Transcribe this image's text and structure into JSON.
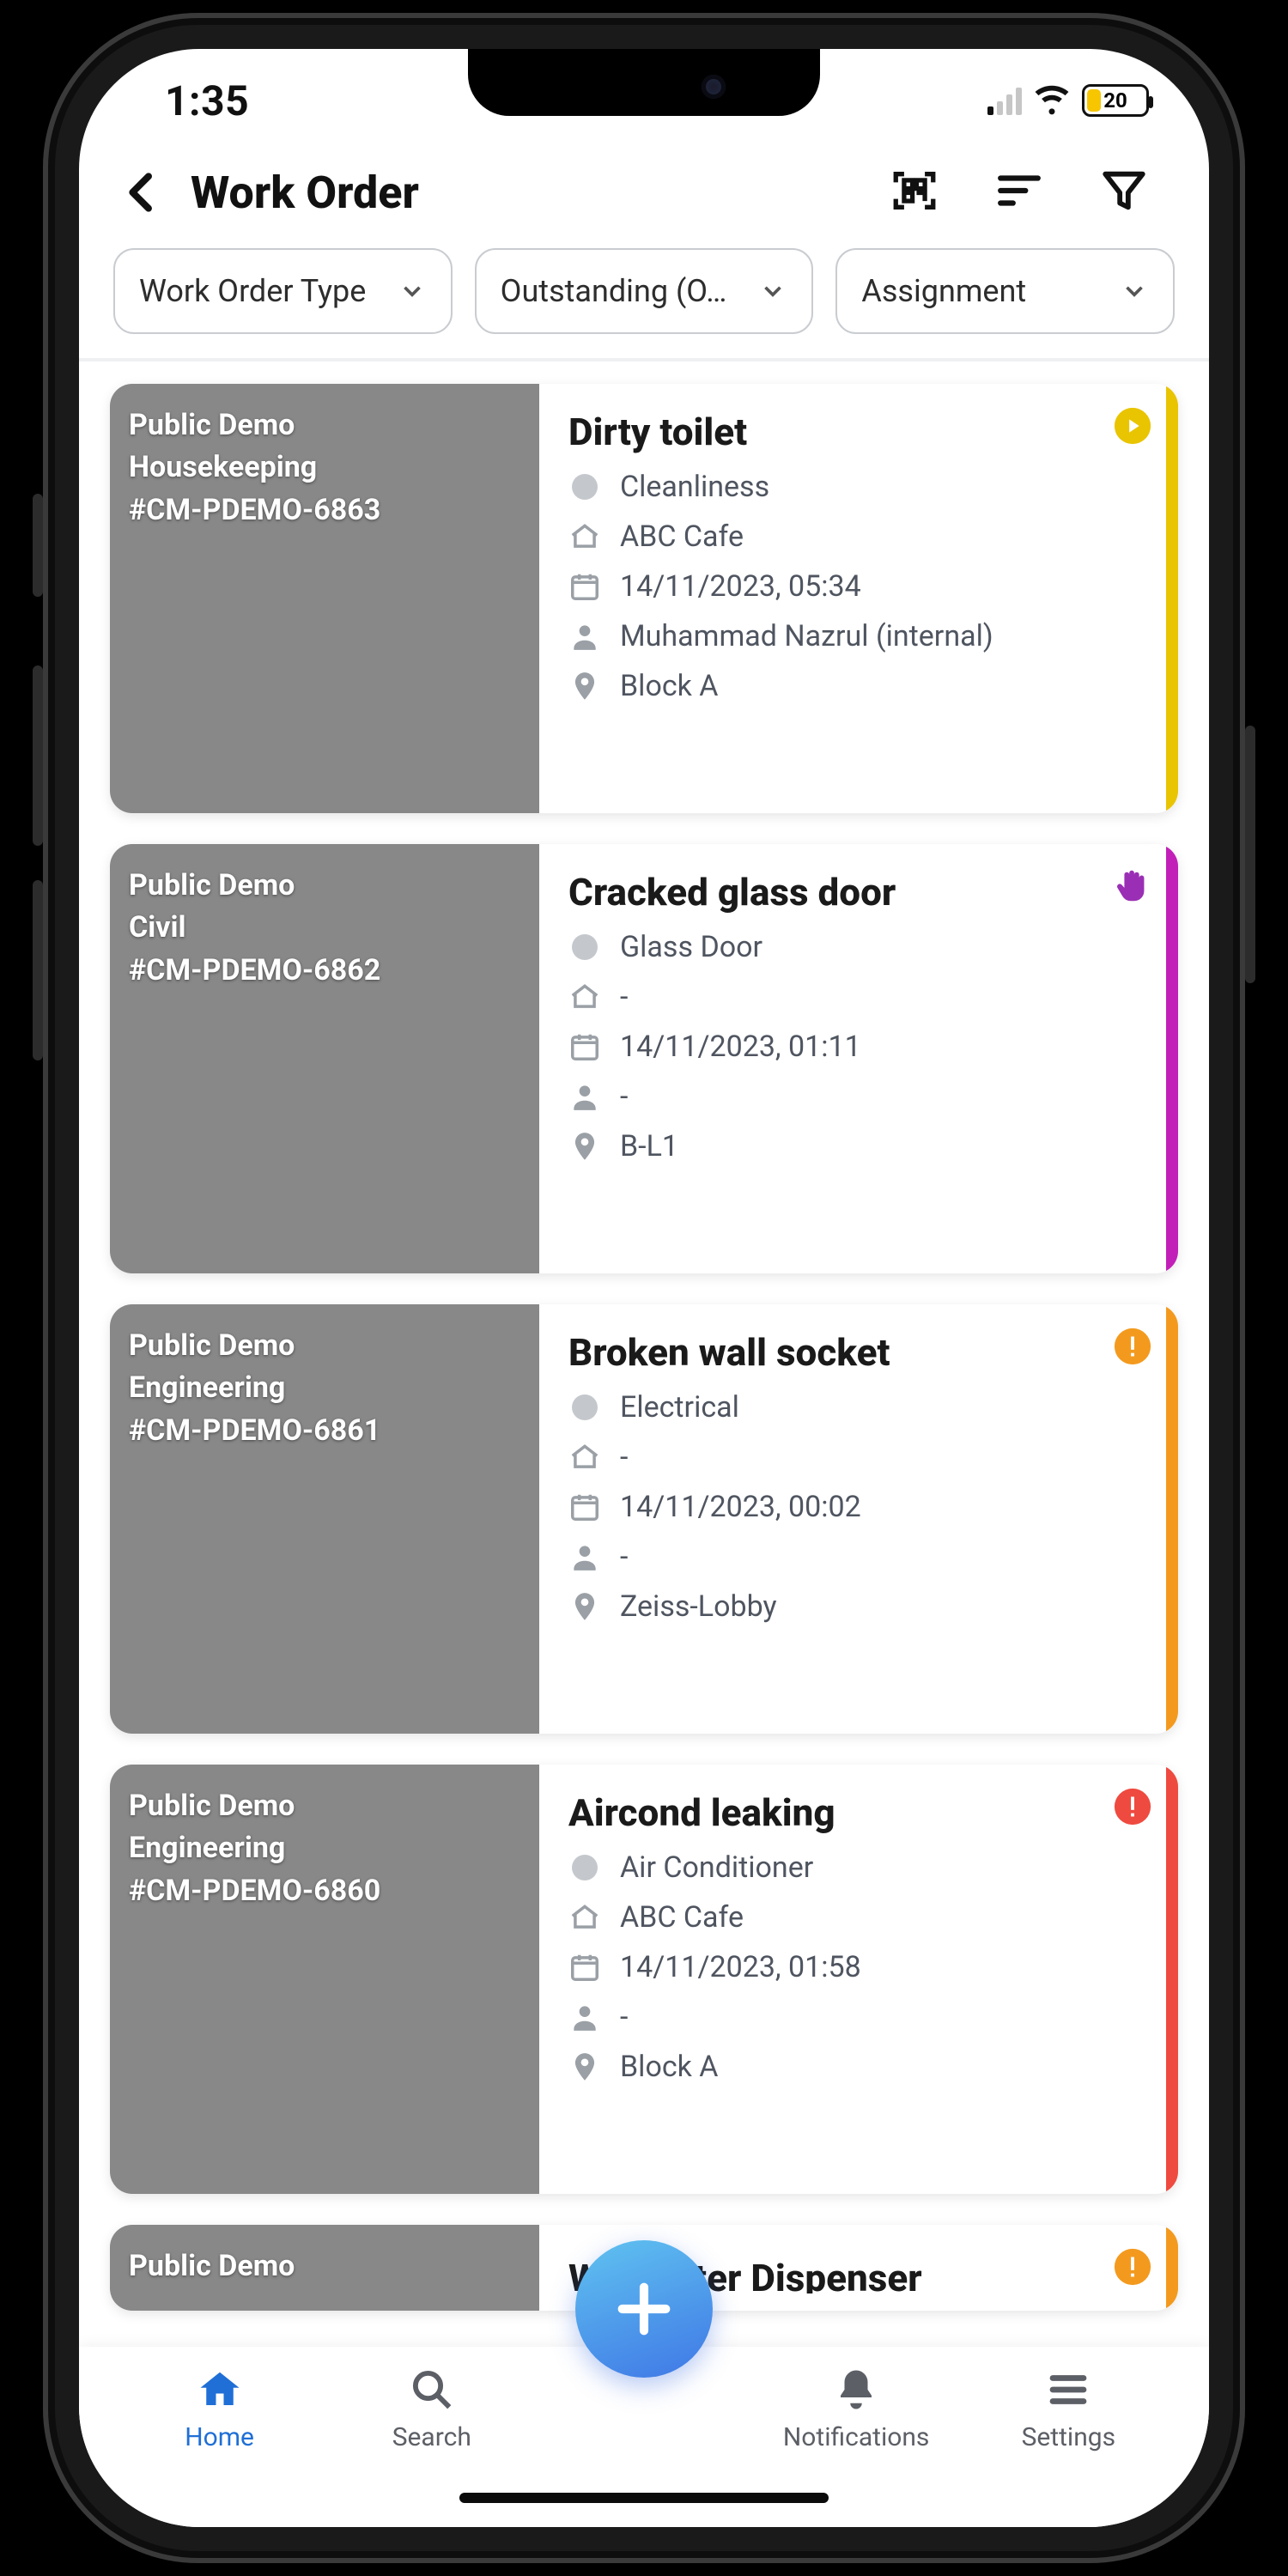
{
  "device": {
    "time": "1:35",
    "battery_pct": "20"
  },
  "header": {
    "title": "Work Order"
  },
  "filters": {
    "type": {
      "label": "Work Order Type"
    },
    "status": {
      "label": "Outstanding (O…"
    },
    "assign": {
      "label": "Assignment"
    }
  },
  "stripe_colors": {
    "yellow": "#e9c400",
    "magenta": "#c21fb9",
    "orange": "#f39a1e",
    "red": "#ef4a3f"
  },
  "badge_colors": {
    "play": "#e9c400",
    "hand": "#9a2fb5",
    "warn_o": "#f39a1e",
    "warn_r": "#ef4a3f"
  },
  "orders": [
    {
      "over1": "Public Demo",
      "over2": "Housekeeping",
      "over3": "#CM-PDEMO-6863",
      "title": "Dirty toilet",
      "category": "Cleanliness",
      "place": "ABC Cafe",
      "datetime": "14/11/2023, 05:34",
      "assignee": "Muhammad Nazrul (internal)",
      "location": "Block A",
      "stripe": "yellow",
      "badge": "play"
    },
    {
      "over1": "Public Demo",
      "over2": "Civil",
      "over3": "#CM-PDEMO-6862",
      "title": "Cracked glass door",
      "category": "Glass Door",
      "place": "-",
      "datetime": "14/11/2023, 01:11",
      "assignee": "-",
      "location": "B-L1",
      "stripe": "magenta",
      "badge": "hand"
    },
    {
      "over1": "Public Demo",
      "over2": "Engineering",
      "over3": "#CM-PDEMO-6861",
      "title": "Broken wall socket",
      "category": "Electrical",
      "place": "-",
      "datetime": "14/11/2023, 00:02",
      "assignee": "-",
      "location": "Zeiss-Lobby",
      "stripe": "orange",
      "badge": "warn_o"
    },
    {
      "over1": "Public Demo",
      "over2": "Engineering",
      "over3": "#CM-PDEMO-6860",
      "title": "Aircond leaking",
      "category": "Air Conditioner",
      "place": "ABC Cafe",
      "datetime": "14/11/2023, 01:58",
      "assignee": "-",
      "location": "Block A",
      "stripe": "red",
      "badge": "warn_r"
    }
  ],
  "peek": {
    "over1": "Public Demo",
    "title_masked": "W            h Water Dispenser",
    "badge": "warn_o",
    "stripe": "orange"
  },
  "tabs": {
    "home": "Home",
    "search": "Search",
    "notifications": "Notifications",
    "settings": "Settings"
  }
}
